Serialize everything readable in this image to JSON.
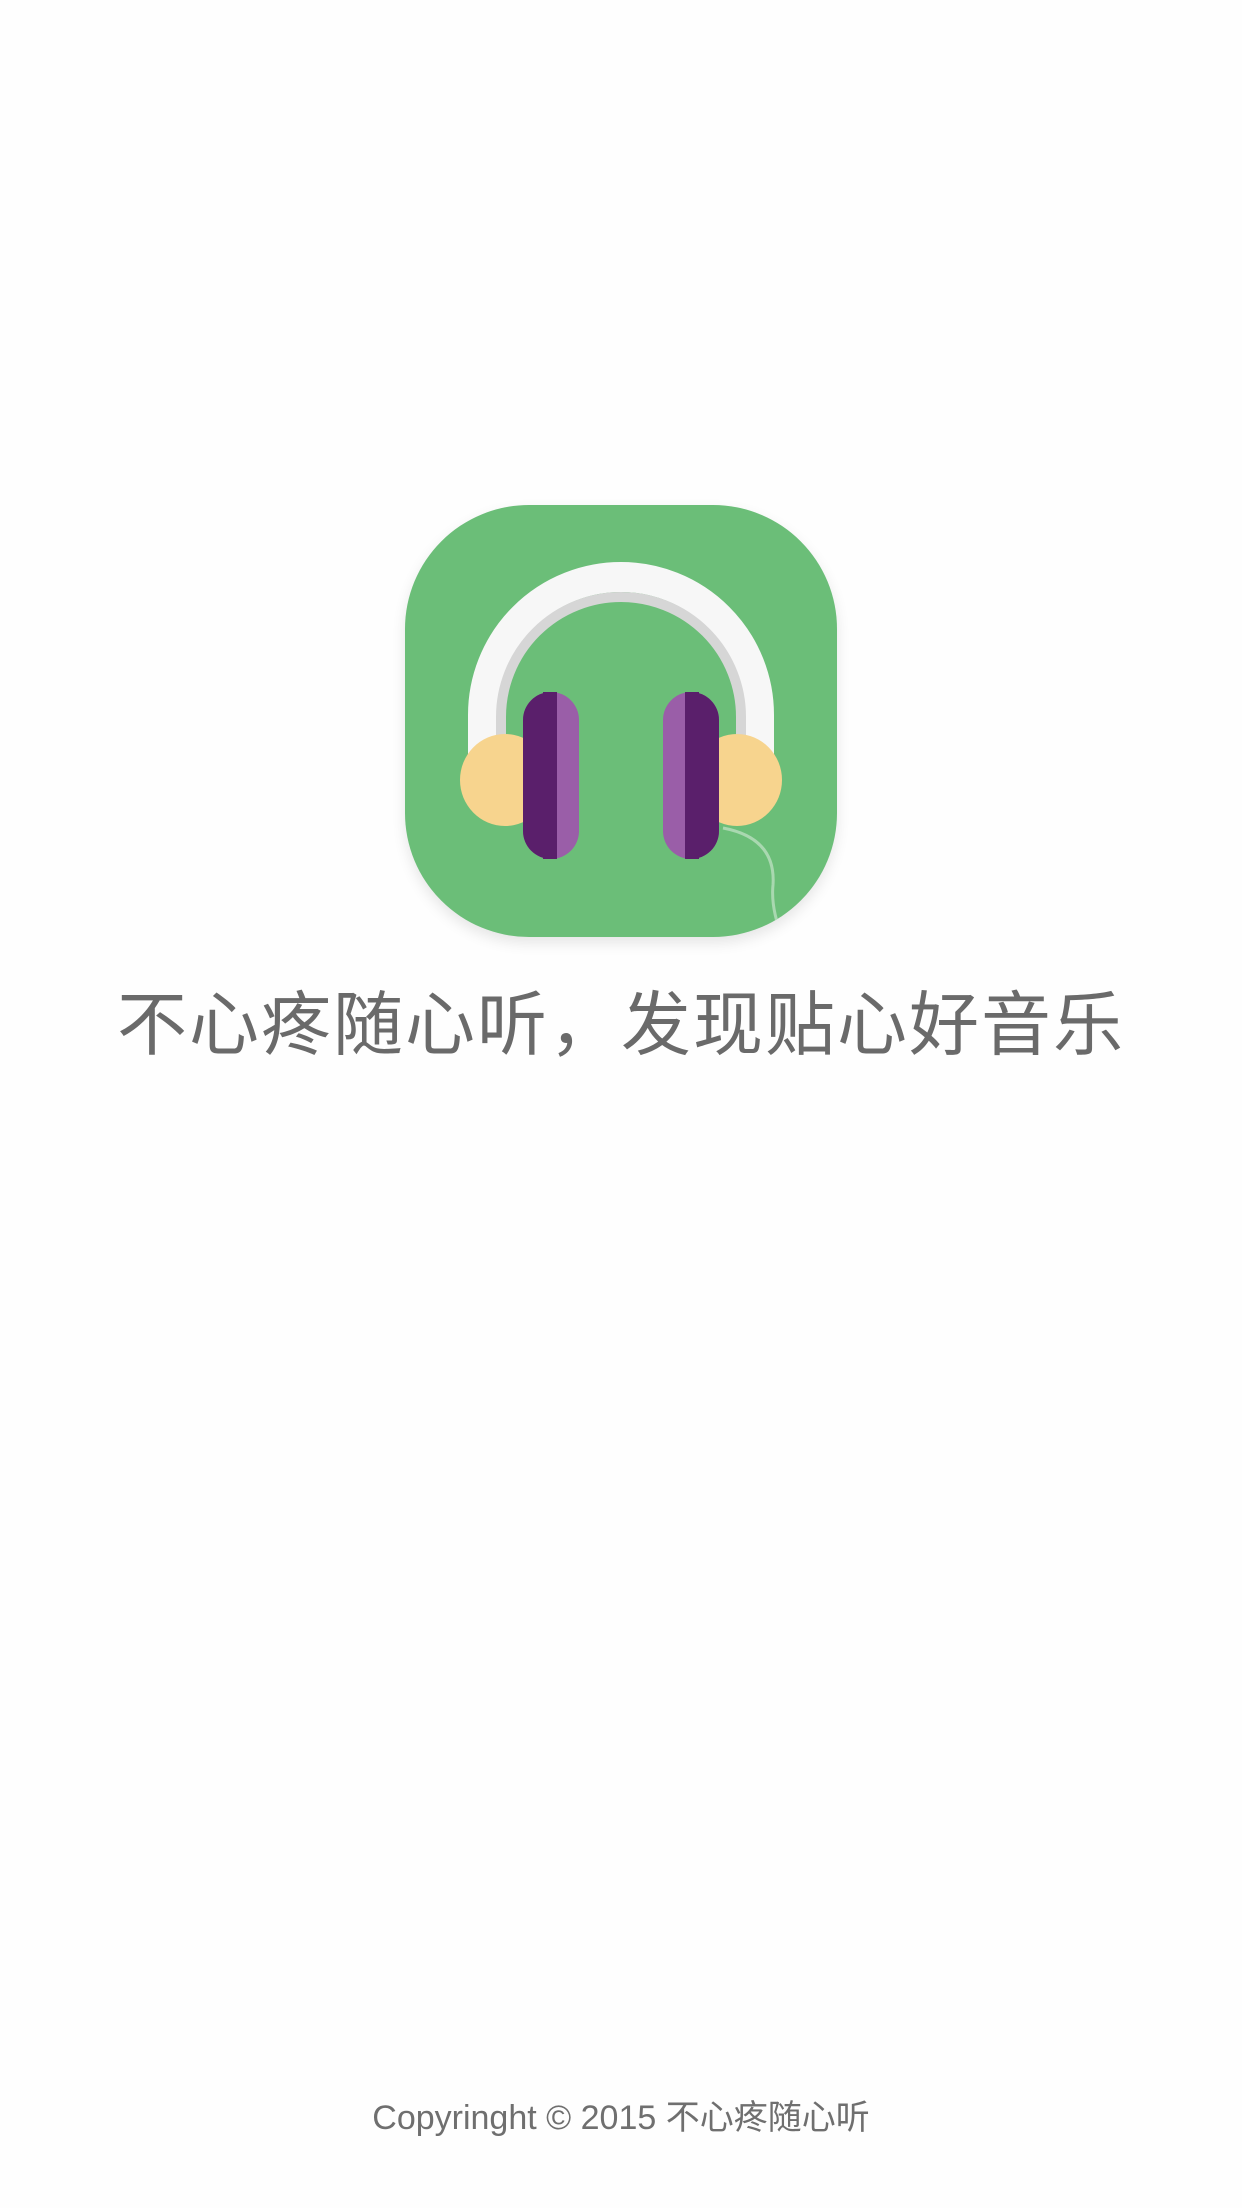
{
  "splash": {
    "logo_icon": "headphones-icon",
    "slogan": "不心疼随心听，发现贴心好音乐",
    "copyright": "Copyringht © 2015 不心疼随心听"
  },
  "colors": {
    "background": "#fefefe",
    "icon_green": "#6bbe78",
    "headband_white": "#f7f7f7",
    "headband_gray": "#d6d6d6",
    "ear_cushion": "#f7d48e",
    "earcup_dark_purple": "#5a1f6b",
    "earcup_light_purple": "#9a5ea8",
    "text_gray": "#6a6a6a"
  }
}
